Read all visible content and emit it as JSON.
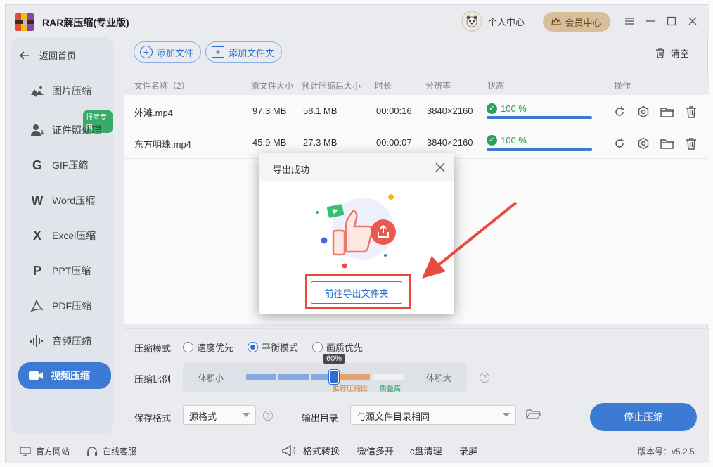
{
  "app": {
    "title": "RAR解压缩(专业版)"
  },
  "header": {
    "profile_label": "个人中心",
    "vip_label": "会员中心"
  },
  "sidebar": {
    "back_label": "返回首页",
    "items": [
      {
        "label": "图片压缩",
        "icon": "image-compress-icon"
      },
      {
        "label": "证件照处理",
        "icon": "id-photo-icon",
        "badge": "报考专用"
      },
      {
        "label": "GIF压缩",
        "icon": "gif-icon"
      },
      {
        "label": "Word压缩",
        "icon": "word-icon"
      },
      {
        "label": "Excel压缩",
        "icon": "excel-icon"
      },
      {
        "label": "PPT压缩",
        "icon": "ppt-icon"
      },
      {
        "label": "PDF压缩",
        "icon": "pdf-icon"
      },
      {
        "label": "音频压缩",
        "icon": "audio-icon"
      },
      {
        "label": "视频压缩",
        "icon": "video-icon",
        "active": true
      }
    ]
  },
  "toolbar": {
    "add_file": "添加文件",
    "add_folder": "添加文件夹",
    "clear": "清空"
  },
  "table": {
    "headers": [
      "文件名称（2）",
      "原文件大小",
      "预计压缩后大小",
      "时长",
      "分辨率",
      "状态",
      "操作"
    ],
    "rows": [
      {
        "name": "外滩.mp4",
        "orig_size": "97.3 MB",
        "est_size": "58.1 MB",
        "duration": "00:00:16",
        "resolution": "3840×2160",
        "status": "100 %",
        "progress": 1.0
      },
      {
        "name": "东方明珠.mp4",
        "orig_size": "45.9 MB",
        "est_size": "27.3 MB",
        "duration": "00:00:07",
        "resolution": "3840×2160",
        "status": "100 %",
        "progress": 1.0
      }
    ]
  },
  "settings": {
    "mode_label": "压缩模式",
    "modes": [
      "速度优先",
      "平衡模式",
      "画质优先"
    ],
    "selected_mode": "平衡模式",
    "ratio_label": "压缩比例",
    "ratio_small": "体积小",
    "ratio_large": "体积大",
    "ratio_value": "60%",
    "ratio_recommend": "推荐压缩比",
    "ratio_quality": "质量高",
    "format_label": "保存格式",
    "format_value": "源格式",
    "output_label": "输出目录",
    "output_value": "与源文件目录相同",
    "stop_button": "停止压缩"
  },
  "statusbar": {
    "website": "官方网站",
    "service": "在线客服",
    "format_convert": "格式转换",
    "wechat_multi": "微信多开",
    "c_clean": "c盘清理",
    "record": "录屏",
    "version": "版本号：v5.2.5"
  },
  "dialog": {
    "title": "导出成功",
    "button": "前往导出文件夹"
  },
  "colors": {
    "accent": "#3f7dd8",
    "success": "#2ea35f",
    "highlight": "#e84a3c",
    "vip": "#dcc3a0"
  }
}
